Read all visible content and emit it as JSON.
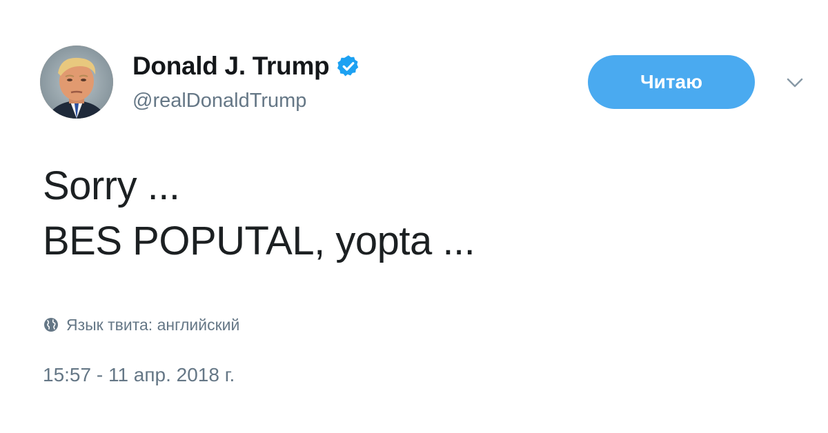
{
  "tweet": {
    "author": {
      "display_name": "Donald J. Trump",
      "handle": "@realDonaldTrump",
      "verified": true,
      "avatar_icon": "avatar-photo"
    },
    "follow_button_label": "Читаю",
    "text_lines": [
      "Sorry ...",
      "BES POPUTAL, yopta ..."
    ],
    "language_label": "Язык твита: английский",
    "timestamp": "15:57 - 11 апр. 2018 г."
  },
  "colors": {
    "accent": "#4aaaf0",
    "verified_badge": "#1da1f2",
    "secondary_text": "#657786",
    "primary_text": "#1c2022"
  },
  "icons": {
    "verified": "verified-badge-icon",
    "caret": "chevron-down-icon",
    "globe": "globe-icon"
  }
}
